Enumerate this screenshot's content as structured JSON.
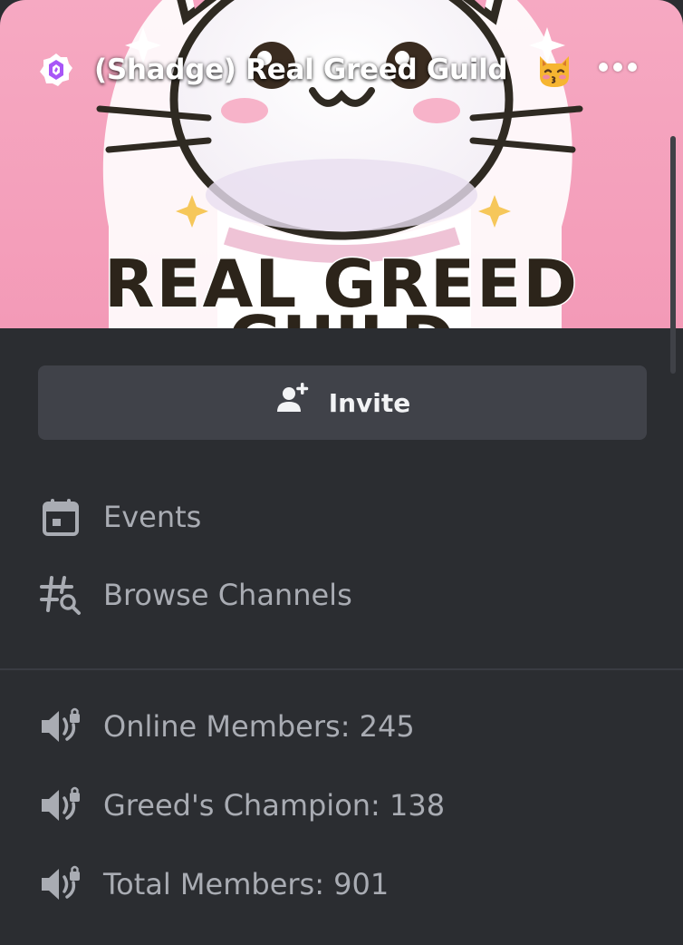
{
  "server": {
    "name": "(Shadge) Real Greed Guild",
    "emoji_icon": "kissing-cat-icon",
    "badge_icon": "server-boost-badge-icon",
    "banner_text": "REAL GREED",
    "banner_text_partial": "GUILD"
  },
  "header": {
    "more_icon": "more-horizontal-icon"
  },
  "invite": {
    "label": "Invite",
    "icon": "add-user-icon"
  },
  "menu": {
    "events": {
      "label": "Events",
      "icon": "calendar-icon"
    },
    "browse_channels": {
      "label": "Browse Channels",
      "icon": "browse-channels-icon"
    }
  },
  "channels": [
    {
      "label": "Online Members: 245",
      "icon": "locked-voice-channel-icon"
    },
    {
      "label": "Greed's Champion: 138",
      "icon": "locked-voice-channel-icon"
    },
    {
      "label": "Total Members: 901",
      "icon": "locked-voice-channel-icon"
    }
  ],
  "colors": {
    "background": "#2b2d31",
    "button": "#404249",
    "text_muted": "#a9acb3",
    "banner_pink": "#f7a8c0",
    "badge_purple": "#a855f7"
  }
}
